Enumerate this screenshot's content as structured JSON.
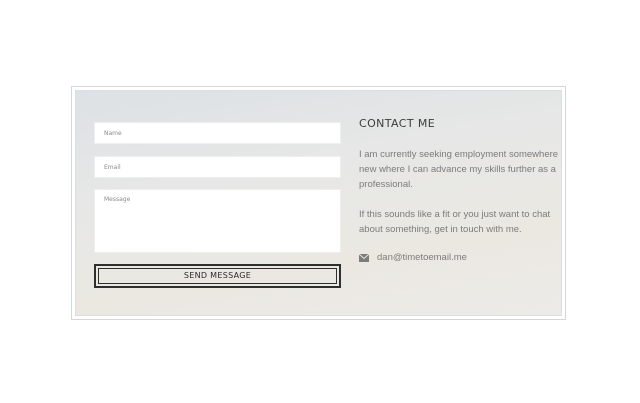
{
  "form": {
    "name_placeholder": "Name",
    "email_placeholder": "Email",
    "message_placeholder": "Message",
    "send_label": "SEND MESSAGE"
  },
  "contact": {
    "title": "CONTACT ME",
    "paragraph1": "I am currently seeking employment somewhere new where I can advance my skills further as a professional.",
    "paragraph2": "If this sounds like a fit or you just want to chat about something, get in touch with me.",
    "email": "dan@timetoemail.me",
    "email_icon": "envelope-icon"
  },
  "colors": {
    "text_dark": "#3c3c3c",
    "text_muted": "#7c7c7c",
    "button_border": "#2f2f2f"
  }
}
